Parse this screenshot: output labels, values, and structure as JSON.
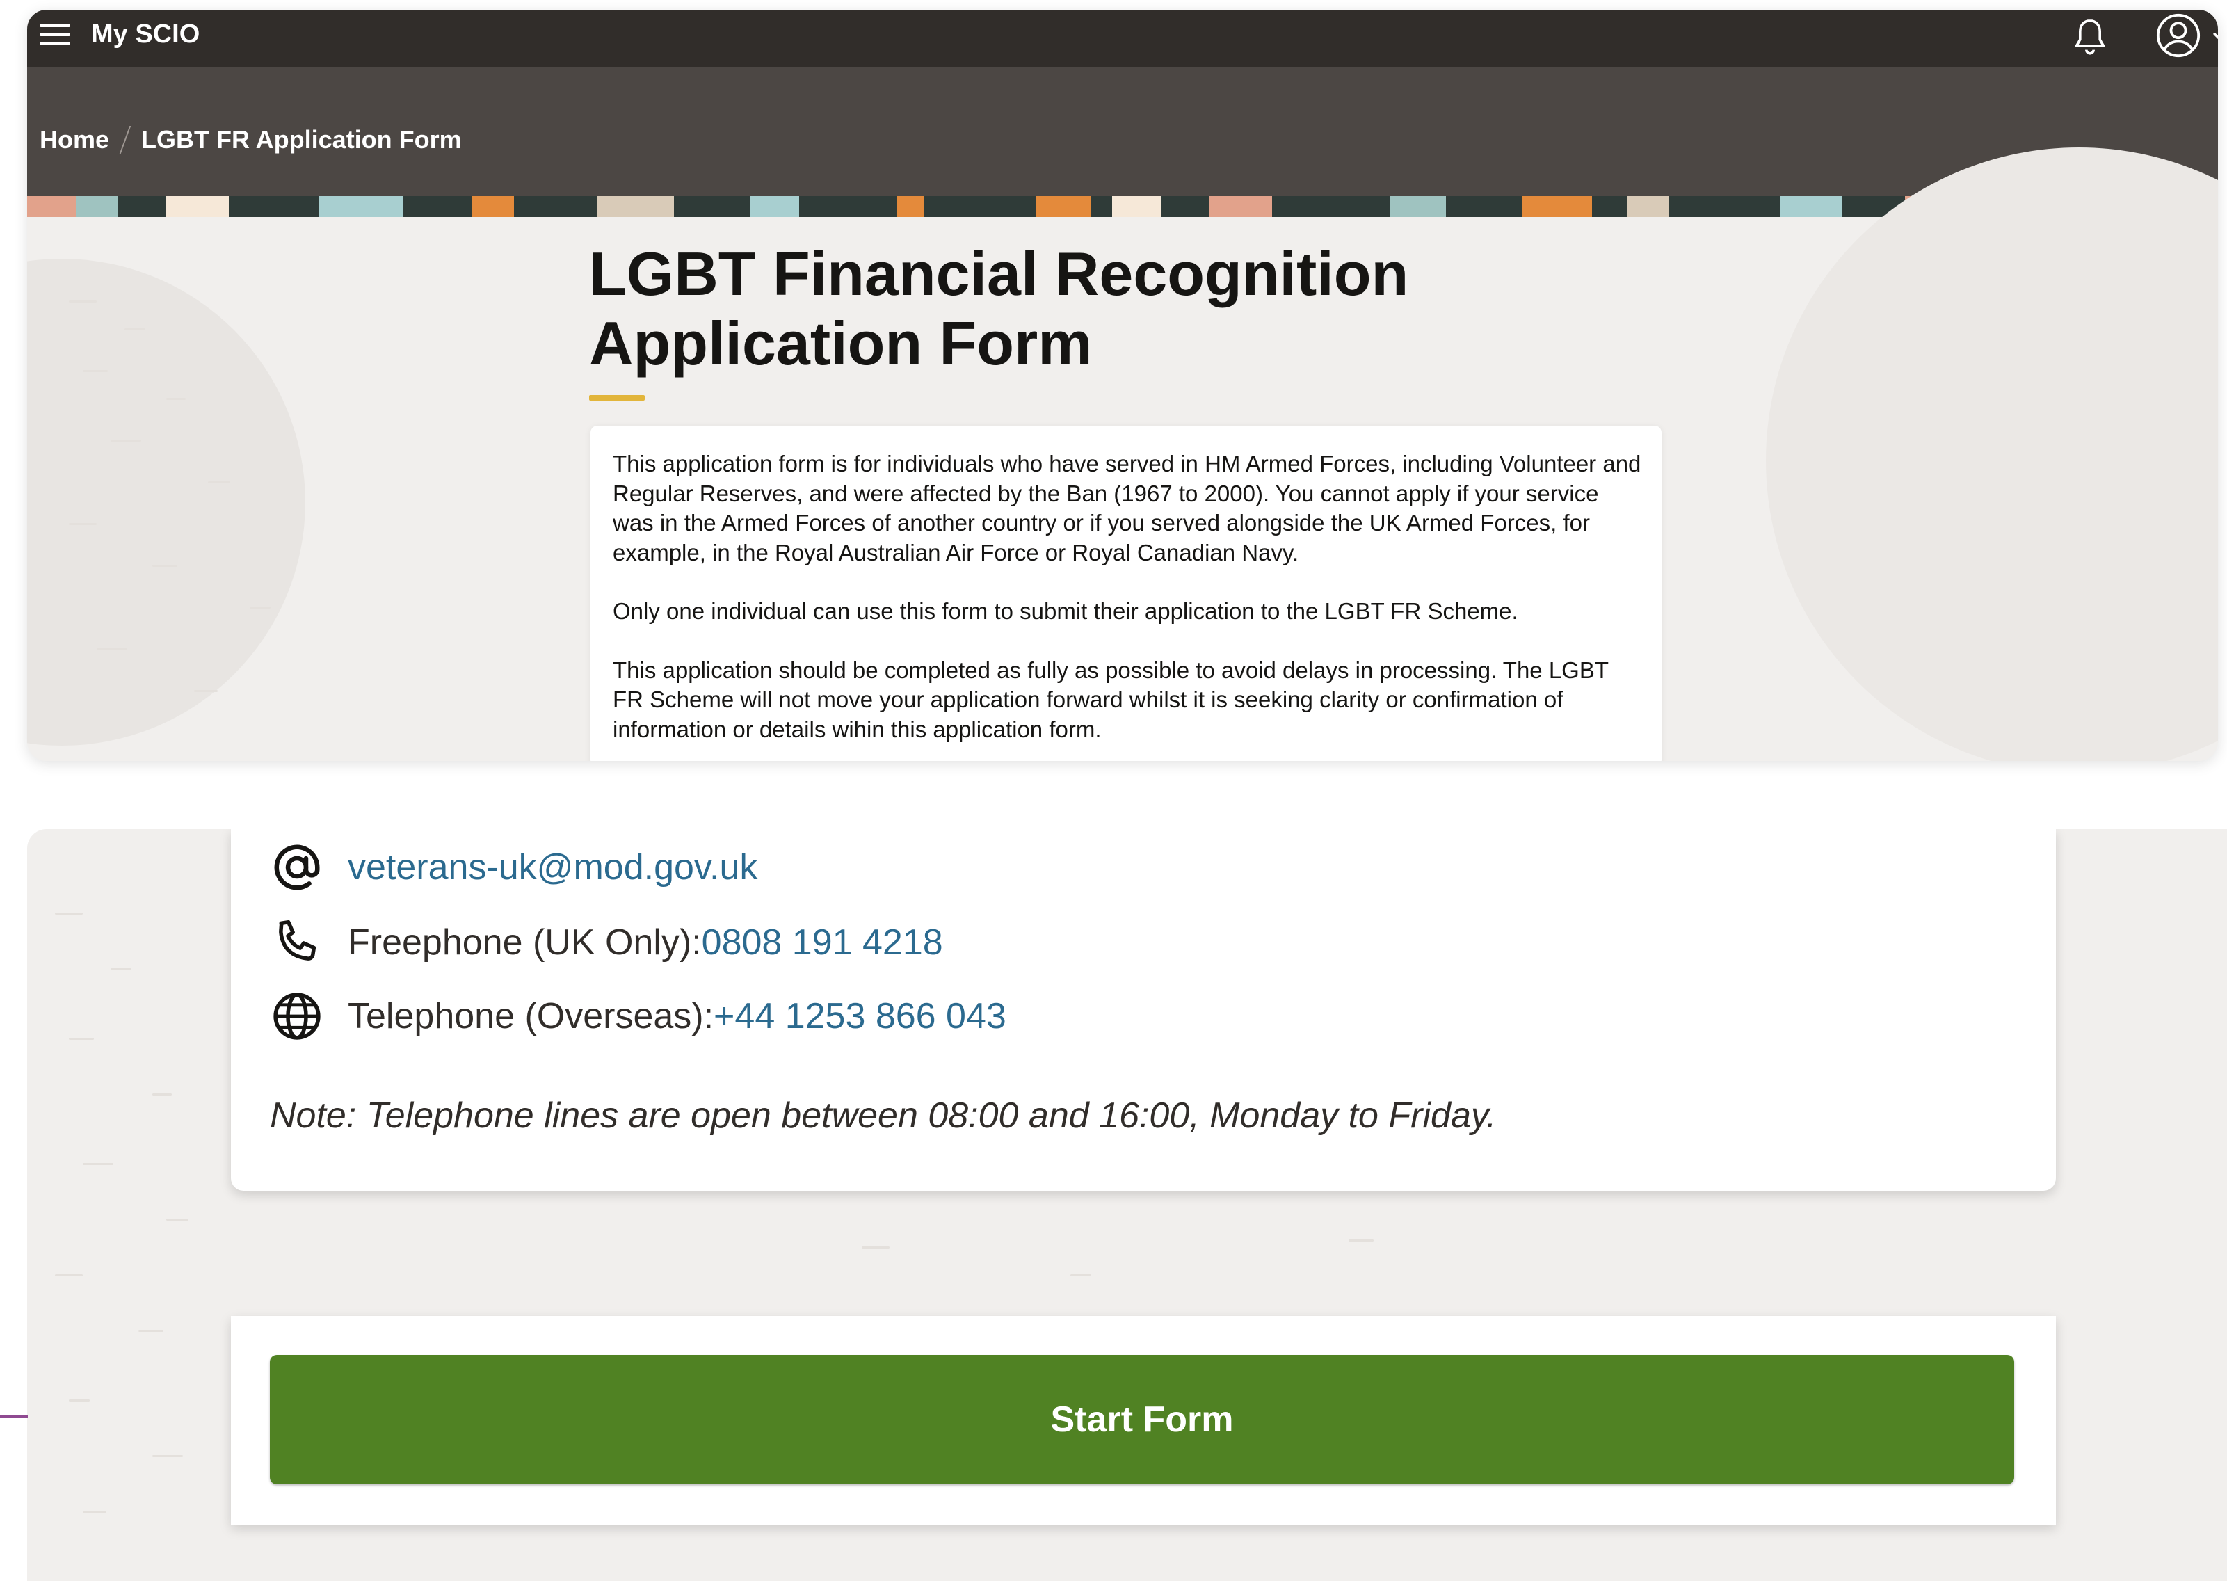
{
  "header": {
    "app_title": "My SCIO",
    "icons": [
      "hamburger-menu-icon",
      "bell-icon",
      "user-avatar-icon",
      "chevron-down-icon"
    ]
  },
  "breadcrumb": {
    "home": "Home",
    "current": "LGBT FR Application Form"
  },
  "page": {
    "title_line1": "LGBT Financial Recognition",
    "title_line2": "Application Form",
    "intro_paragraphs": [
      "This application form is for individuals who have served in HM Armed Forces, including Volunteer and Regular Reserves, and were affected by the Ban (1967 to 2000). You cannot apply if your service was in the Armed Forces of another country or if you served alongside the UK Armed Forces, for example, in the Royal Australian Air Force or Royal Canadian Navy.",
      "Only one individual can use this form to submit their application to the LGBT FR Scheme.",
      "This application should be completed as fully as possible to avoid delays in processing. The LGBT FR Scheme will not move your application forward whilst it is seeking clarity or confirmation of information or details wihin this application form."
    ]
  },
  "contact": {
    "email": "veterans-uk@mod.gov.uk",
    "freephone_label": "Freephone (UK Only): ",
    "freephone_number": "0808 191 4218",
    "overseas_label": "Telephone (Overseas): ",
    "overseas_number": "+44 1253 866 043",
    "note": "Note: Telephone lines are open between 08:00 and 16:00, Monday to Friday."
  },
  "actions": {
    "start_label": "Start Form"
  },
  "colors": {
    "topbar": "#312d2a",
    "crumbbar": "#4c4744",
    "accent": "#e2b53b",
    "link": "#2b6a8f",
    "button": "#508223"
  }
}
